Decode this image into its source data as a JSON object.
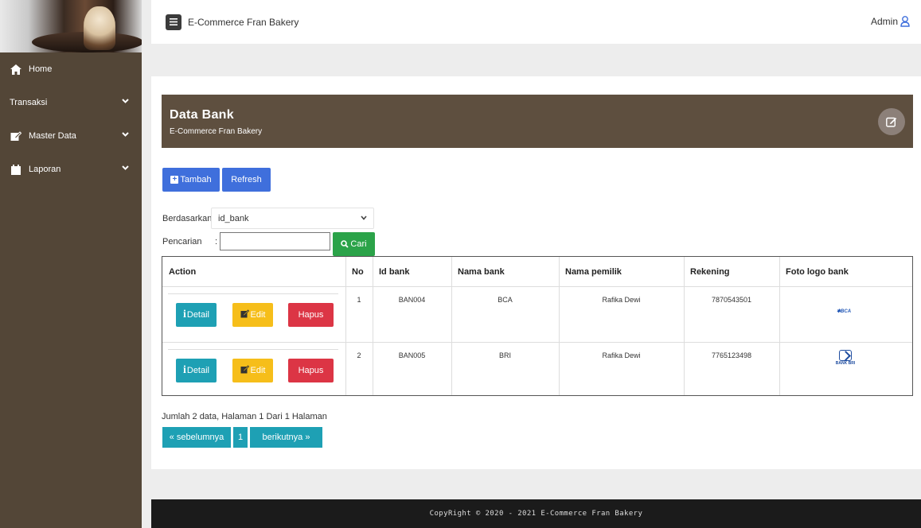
{
  "topbar": {
    "title": "E-Commerce Fran Bakery",
    "user": "Admin"
  },
  "sidebar": {
    "items": [
      {
        "label": "Home",
        "icon": "home-icon"
      },
      {
        "label": "Transaksi",
        "icon": "",
        "expandable": true
      },
      {
        "label": "Master Data",
        "icon": "edit-icon",
        "expandable": true
      },
      {
        "label": "Laporan",
        "icon": "calendar-icon",
        "expandable": true
      }
    ]
  },
  "card": {
    "title": "Data Bank",
    "subtitle": "E-Commerce Fran Bakery"
  },
  "toolbar": {
    "tambah": "Tambah",
    "refresh": "Refresh"
  },
  "filter": {
    "berdasarkan_label": "Berdasarkan:",
    "berdasarkan_value": "id_bank",
    "pencarian_label": "Pencarian",
    "pencarian_colon": ":",
    "pencarian_value": "",
    "cari": "Cari"
  },
  "table": {
    "headers": [
      "Action",
      "No",
      "Id bank",
      "Nama bank",
      "Nama pemilik",
      "Rekening",
      "Foto logo bank"
    ],
    "rows": [
      {
        "no": "1",
        "id_bank": "BAN004",
        "nama_bank": "BCA",
        "nama_pemilik": "Rafika Dewi",
        "rekening": "7870543501",
        "logo": "BCA"
      },
      {
        "no": "2",
        "id_bank": "BAN005",
        "nama_bank": "BRI",
        "nama_pemilik": "Rafika Dewi",
        "rekening": "7765123498",
        "logo": "BANK BRI"
      }
    ],
    "actions": {
      "detail": "Detail",
      "edit": "Edit",
      "hapus": "Hapus"
    }
  },
  "summary": "Jumlah 2 data, Halaman 1 Dari 1 Halaman",
  "pagination": {
    "prev": "« sebelumnya",
    "current": "1",
    "next": "berikutnya »"
  },
  "footer": "CopyRight © 2020 - 2021 E-Commerce Fran Bakery",
  "colors": {
    "sidebar": "#534637",
    "header": "#5e4f3f",
    "primary": "#3f6fdc",
    "info": "#1ea0b4",
    "warning": "#f6be1a",
    "danger": "#dc3545",
    "success": "#2ba349"
  }
}
